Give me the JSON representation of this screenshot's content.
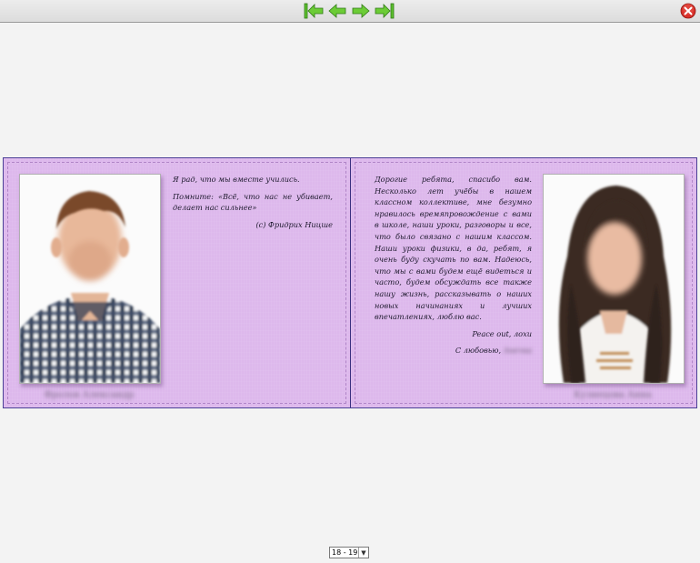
{
  "toolbar": {
    "first_icon": "first-page-icon",
    "prev_icon": "prev-page-icon",
    "next_icon": "next-page-icon",
    "last_icon": "last-page-icon",
    "close_icon": "close-icon",
    "nav_color": "#5dc12e",
    "close_color": "#d8302a"
  },
  "book": {
    "page_color": "#ddb8ec",
    "border_color": "#4b3f96",
    "left_page": {
      "caption": "Фролов Александр",
      "quote_intro": "Я рад, что мы вместе учились.",
      "quote": "Помните: «Всё, что нас не убивает, делает нас сильнее»",
      "quote_author": "(с) Фридрих Ницше"
    },
    "right_page": {
      "caption": "Кузнецова Анна",
      "message": "Дорогие ребята, спасибо вам. Несколько лет учёбы в нашем классном коллективе, мне безумно нравилось времяпровождение с вами в школе, наши уроки, разговоры и все, что было связано с нашим классом. Наши уроки физики, в да, ребят, я очень буду скучать по вам. Надеюсь, что мы с вами будем ещё видеться и часто, будем обсуждать все также нашу жизнь, рассказывать о наших новых начинаниях и лучших впечатлениях, люблю вас.",
      "signoff": "Peace out, лохи",
      "love_prefix": "С любовью,",
      "love_name": "Анечка"
    }
  },
  "pager": {
    "selected": "18 - 19"
  }
}
